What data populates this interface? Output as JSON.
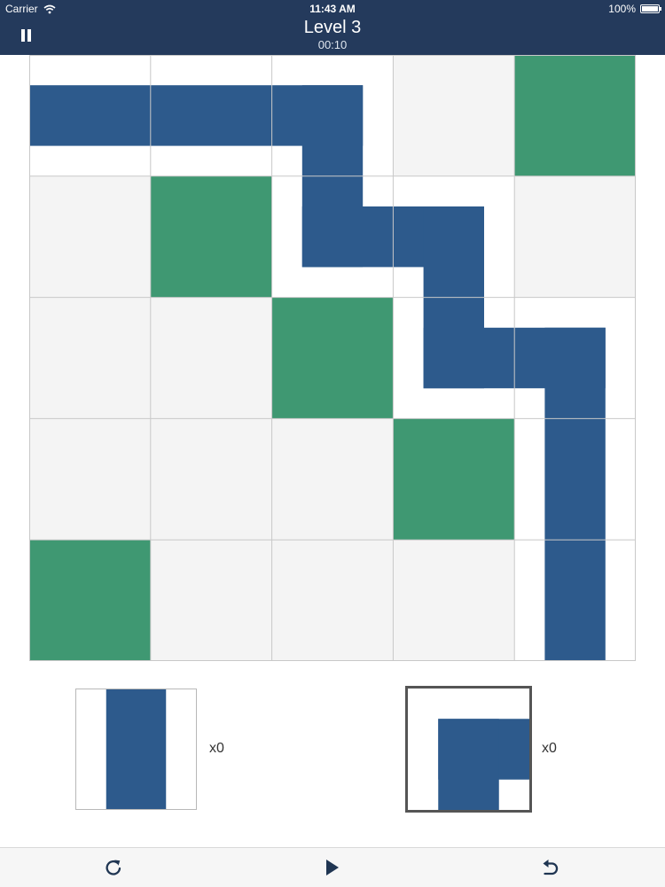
{
  "status_bar": {
    "carrier": "Carrier",
    "time": "11:43 AM",
    "battery": "100%"
  },
  "header": {
    "title": "Level 3",
    "timer": "00:10"
  },
  "colors": {
    "bar": "#243a5c",
    "pipe": "#2d5a8c",
    "block": "#3f9872",
    "empty_cell": "#f4f4f4",
    "path_cell": "#ffffff",
    "grid_line": "#c8c8c8"
  },
  "board": {
    "rows": 5,
    "cols": 5,
    "tiles": [
      [
        "straight-h",
        "straight-h",
        "corner-west-south",
        "empty",
        "block"
      ],
      [
        "empty",
        "block",
        "corner-north-east",
        "corner-west-south",
        "empty"
      ],
      [
        "empty",
        "empty",
        "block",
        "corner-north-east",
        "corner-west-south"
      ],
      [
        "empty",
        "empty",
        "empty",
        "block",
        "straight-v"
      ],
      [
        "block",
        "empty",
        "empty",
        "empty",
        "straight-v"
      ]
    ]
  },
  "pieces": [
    {
      "tile": "straight-v",
      "count": "x0",
      "selected": false
    },
    {
      "tile": "corner-east-south",
      "count": "x0",
      "selected": true
    }
  ],
  "toolbar": {
    "restart_icon": "restart-icon",
    "play_icon": "play-icon",
    "undo_icon": "undo-icon"
  }
}
